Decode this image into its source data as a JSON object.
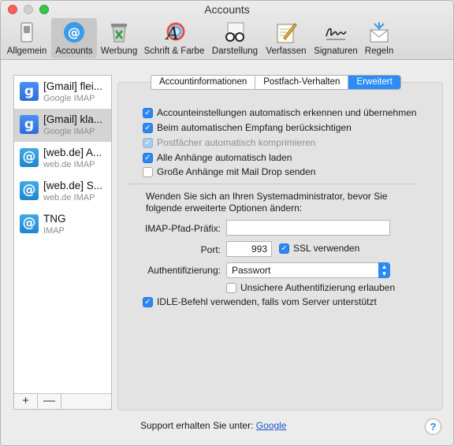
{
  "window": {
    "title": "Accounts"
  },
  "toolbar": {
    "items": [
      {
        "label": "Allgemein",
        "icon": "general-switch-icon"
      },
      {
        "label": "Accounts",
        "icon": "at-sign-icon",
        "selected": true
      },
      {
        "label": "Werbung",
        "icon": "junk-bin-icon"
      },
      {
        "label": "Schrift & Farbe",
        "icon": "font-color-icon"
      },
      {
        "label": "Darstellung",
        "icon": "glasses-icon"
      },
      {
        "label": "Verfassen",
        "icon": "pencil-notepad-icon"
      },
      {
        "label": "Signaturen",
        "icon": "signature-icon"
      },
      {
        "label": "Regeln",
        "icon": "rules-envelope-icon"
      }
    ]
  },
  "sidebar": {
    "accounts": [
      {
        "name": "[Gmail] flei...",
        "type": "Google IMAP",
        "icon": "google-icon"
      },
      {
        "name": "[Gmail] kla...",
        "type": "Google IMAP",
        "icon": "google-icon",
        "selected": true
      },
      {
        "name": "[web.de] A...",
        "type": "web.de IMAP",
        "icon": "at-sign-icon"
      },
      {
        "name": "[web.de] S...",
        "type": "web.de IMAP",
        "icon": "at-sign-icon"
      },
      {
        "name": "TNG",
        "type": "IMAP",
        "icon": "at-sign-icon"
      }
    ],
    "add_label": "+",
    "remove_label": "—"
  },
  "tabs": [
    {
      "label": "Accountinformationen"
    },
    {
      "label": "Postfach-Verhalten"
    },
    {
      "label": "Erweitert",
      "active": true
    }
  ],
  "options": {
    "auto_detect": {
      "label": "Accounteinstellungen automatisch erkennen und übernehmen",
      "checked": true
    },
    "auto_receive": {
      "label": "Beim automatischen Empfang berücksichtigen",
      "checked": true
    },
    "compress": {
      "label": "Postfächer automatisch komprimieren",
      "checked": true,
      "disabled": true
    },
    "download_attachments": {
      "label": "Alle Anhänge automatisch laden",
      "checked": true
    },
    "mail_drop": {
      "label": "Große Anhänge mit Mail Drop senden",
      "checked": false
    }
  },
  "advanced": {
    "note": "Wenden Sie sich an Ihren Systemadministrator, bevor Sie folgende erweiterte Optionen ändern:",
    "imap_prefix_label": "IMAP-Pfad-Präfix:",
    "imap_prefix_value": "",
    "port_label": "Port:",
    "port_value": "993",
    "ssl_label": "SSL verwenden",
    "ssl_checked": true,
    "auth_label": "Authentifizierung:",
    "auth_value": "Passwort",
    "insecure_auth_label": "Unsichere Authentifizierung erlauben",
    "insecure_auth_checked": false,
    "idle_label": "IDLE-Befehl verwenden, falls vom Server unterstützt",
    "idle_checked": true
  },
  "footer": {
    "support_text": "Support erhalten Sie unter:",
    "support_link": "Google",
    "help_label": "?"
  },
  "colors": {
    "accent": "#2c88f0",
    "selection": "#d4d4d4"
  }
}
